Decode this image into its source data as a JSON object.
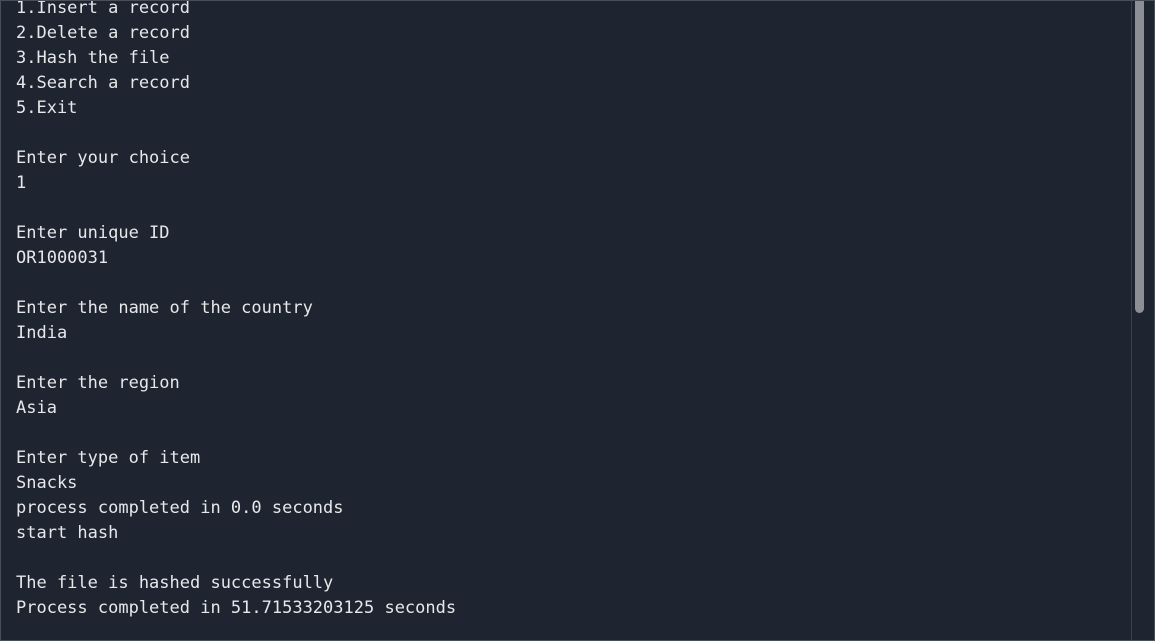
{
  "console": {
    "lines": [
      "1.Insert a record",
      "2.Delete a record",
      "3.Hash the file",
      "4.Search a record",
      "5.Exit",
      "",
      "Enter your choice",
      "1",
      "",
      "Enter unique ID",
      "OR1000031",
      "",
      "Enter the name of the country",
      "India",
      "",
      "Enter the region",
      "Asia",
      "",
      "Enter type of item",
      "Snacks",
      "process completed in 0.0 seconds",
      "start hash",
      "",
      "The file is hashed successfully",
      "Process completed in 51.71533203125 seconds"
    ]
  }
}
